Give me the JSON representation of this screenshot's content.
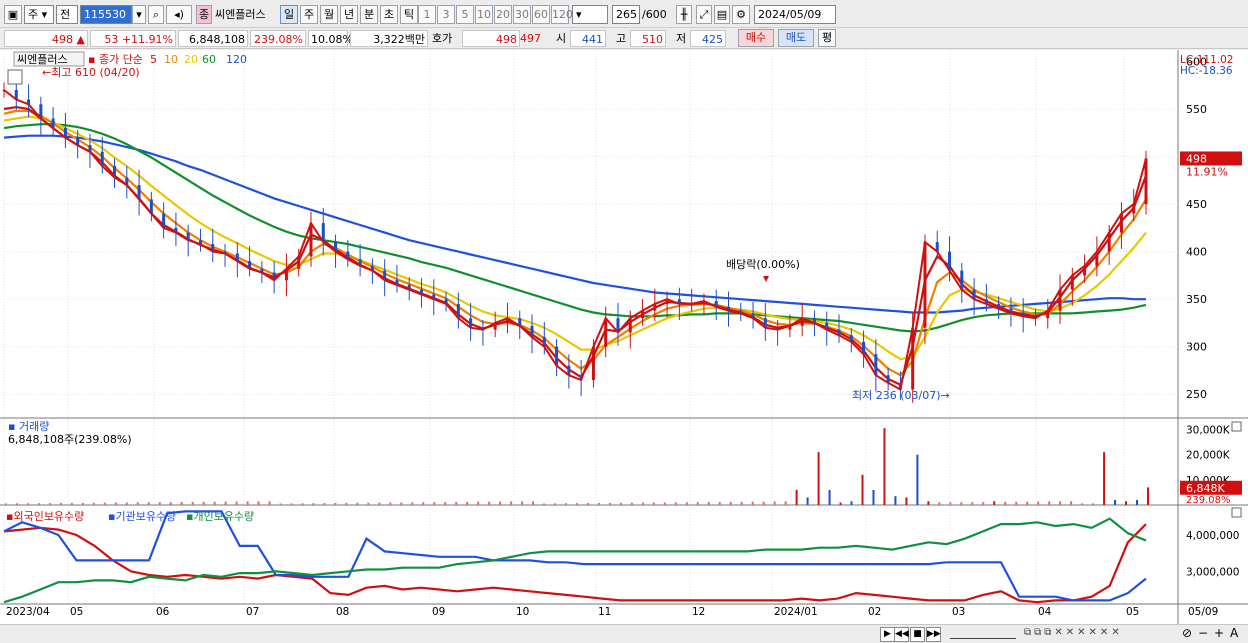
{
  "toolbar": {
    "market_label": "주",
    "prev_label": "전",
    "code": "115530",
    "type_label": "종",
    "stock_name": "씨엔플러스",
    "periods": [
      "일",
      "주",
      "월",
      "년",
      "분",
      "초",
      "틱"
    ],
    "intervals": [
      "1",
      "3",
      "5",
      "10",
      "20",
      "30",
      "60",
      "120"
    ],
    "count": "265",
    "max_count": "/600",
    "date": "2024/05/09"
  },
  "quote": {
    "price": "498",
    "change_arrow": "▲",
    "change": "53",
    "change_pct": "+11.91%",
    "volume": "6,848,108",
    "volume_pct": "239.08%",
    "turnover": "10.08%",
    "amount": "3,322백만",
    "bid_label": "호가",
    "ask": "498",
    "bid": "497",
    "open_label": "시",
    "open": "441",
    "high_label": "고",
    "high": "510",
    "low_label": "저",
    "low": "425",
    "buy_label": "매수",
    "sell_label": "매도",
    "eval_label": "평"
  },
  "legend": {
    "name": "씨엔플러스",
    "series_label": "종가 단순",
    "ma_periods": [
      "5",
      "10",
      "20",
      "60",
      "120"
    ],
    "ma_colors": [
      "#d01010",
      "#f08000",
      "#e8c800",
      "#10902a",
      "#2050e0"
    ]
  },
  "annotations": {
    "lc": "LC:111.02",
    "hc": "HC:-18.36",
    "high_mark": "최고 610 (04/20)",
    "low_mark": "최저 236 (03/07)",
    "dividend": "배당락(0.00%)",
    "price_tag": "498",
    "price_tag_pct": "11.91%"
  },
  "volume_panel": {
    "title": "거래량",
    "value": "6,848,108주(239.08%)",
    "tag": "6,848K",
    "tag_pct": "239.08%"
  },
  "holdings_panel": {
    "titles": [
      "외국인보유수량",
      "기관보유수량",
      "개인보유수량"
    ],
    "colors": [
      "#d01010",
      "#2050e0",
      "#109040"
    ]
  },
  "footer": {
    "buttons": [
      "▶",
      "◀◀",
      "■",
      "▶▶"
    ],
    "zoom": [
      "−",
      "+",
      "A"
    ]
  },
  "chart_data": {
    "type": "line",
    "x_labels": [
      "2023/04",
      "05",
      "06",
      "07",
      "08",
      "09",
      "10",
      "11",
      "12",
      "2024/01",
      "02",
      "03",
      "04",
      "05",
      "05/09"
    ],
    "price_axis": [
      250,
      300,
      350,
      400,
      450,
      500,
      550
    ],
    "price_axis_top": "600",
    "price_ylim": [
      225,
      610
    ],
    "volume_axis": [
      "10,000K",
      "20,000K",
      "30,000K"
    ],
    "volume_ylim": [
      0,
      31000
    ],
    "holdings_axis": [
      "3,000,000",
      "4,000,000"
    ],
    "holdings_ylim": [
      2100000,
      4800000
    ],
    "series": [
      {
        "name": "종가",
        "values": [
          570,
          560,
          555,
          540,
          530,
          520,
          512,
          505,
          490,
          478,
          470,
          455,
          440,
          425,
          420,
          412,
          408,
          400,
          398,
          390,
          382,
          378,
          370,
          382,
          395,
          430,
          410,
          400,
          392,
          385,
          380,
          370,
          365,
          360,
          355,
          350,
          345,
          330,
          320,
          318,
          325,
          330,
          322,
          310,
          300,
          280,
          270,
          265,
          300,
          330,
          315,
          330,
          338,
          345,
          350,
          345,
          345,
          348,
          342,
          338,
          335,
          330,
          320,
          318,
          322,
          330,
          325,
          318,
          312,
          305,
          292,
          270,
          262,
          255,
          320,
          410,
          400,
          380,
          360,
          350,
          345,
          340,
          335,
          332,
          330,
          338,
          360,
          375,
          385,
          400,
          420,
          440,
          450,
          498
        ]
      },
      {
        "name": "5",
        "values": [
          550,
          552,
          550,
          540,
          530,
          520,
          512,
          505,
          494,
          480,
          470,
          456,
          440,
          428,
          421,
          413,
          407,
          402,
          398,
          391,
          383,
          378,
          373,
          380,
          390,
          418,
          412,
          402,
          394,
          386,
          380,
          372,
          366,
          361,
          356,
          351,
          346,
          334,
          324,
          319,
          323,
          327,
          322,
          313,
          304,
          288,
          276,
          268,
          290,
          318,
          316,
          326,
          334,
          341,
          347,
          346,
          345,
          346,
          343,
          339,
          336,
          331,
          323,
          320,
          322,
          327,
          325,
          320,
          315,
          308,
          296,
          278,
          266,
          260,
          300,
          370,
          395,
          385,
          366,
          354,
          348,
          342,
          337,
          334,
          332,
          336,
          352,
          370,
          382,
          396,
          414,
          432,
          446,
          480
        ]
      },
      {
        "name": "10",
        "values": [
          545,
          548,
          548,
          543,
          535,
          526,
          518,
          510,
          500,
          488,
          477,
          465,
          452,
          440,
          430,
          420,
          412,
          405,
          400,
          394,
          388,
          382,
          376,
          378,
          384,
          400,
          408,
          404,
          397,
          390,
          384,
          377,
          371,
          366,
          361,
          356,
          351,
          342,
          333,
          326,
          324,
          325,
          323,
          317,
          309,
          297,
          286,
          277,
          286,
          302,
          310,
          319,
          327,
          334,
          340,
          343,
          344,
          345,
          344,
          341,
          338,
          334,
          328,
          324,
          323,
          325,
          324,
          321,
          317,
          311,
          301,
          289,
          277,
          270,
          285,
          330,
          368,
          378,
          370,
          360,
          353,
          347,
          341,
          337,
          334,
          334,
          345,
          358,
          370,
          384,
          400,
          418,
          434,
          455
        ]
      },
      {
        "name": "20",
        "values": [
          538,
          540,
          542,
          540,
          536,
          530,
          524,
          517,
          509,
          499,
          490,
          480,
          469,
          459,
          449,
          439,
          430,
          422,
          415,
          409,
          402,
          396,
          390,
          386,
          386,
          392,
          398,
          398,
          395,
          391,
          386,
          381,
          376,
          371,
          366,
          362,
          357,
          350,
          343,
          337,
          333,
          331,
          329,
          325,
          320,
          313,
          305,
          297,
          297,
          302,
          306,
          312,
          318,
          324,
          330,
          334,
          337,
          340,
          341,
          340,
          339,
          337,
          334,
          331,
          329,
          328,
          327,
          325,
          322,
          318,
          312,
          304,
          295,
          287,
          289,
          310,
          336,
          354,
          360,
          358,
          355,
          351,
          347,
          343,
          339,
          337,
          340,
          346,
          354,
          364,
          376,
          390,
          404,
          420
        ]
      },
      {
        "name": "60",
        "values": [
          530,
          532,
          533,
          534,
          534,
          533,
          531,
          528,
          524,
          519,
          513,
          506,
          499,
          491,
          483,
          475,
          467,
          459,
          452,
          445,
          438,
          432,
          426,
          421,
          417,
          414,
          412,
          410,
          408,
          405,
          402,
          399,
          396,
          393,
          389,
          386,
          383,
          379,
          375,
          371,
          367,
          363,
          359,
          355,
          351,
          347,
          343,
          339,
          336,
          334,
          333,
          332,
          332,
          332,
          333,
          333,
          334,
          334,
          335,
          335,
          335,
          334,
          333,
          332,
          331,
          330,
          329,
          328,
          327,
          325,
          323,
          321,
          319,
          317,
          316,
          317,
          320,
          324,
          328,
          331,
          333,
          334,
          335,
          335,
          335,
          335,
          335,
          335,
          336,
          337,
          338,
          339,
          341,
          344
        ]
      },
      {
        "name": "120",
        "values": [
          520,
          521,
          522,
          522,
          522,
          521,
          520,
          518,
          516,
          513,
          510,
          507,
          503,
          499,
          495,
          490,
          486,
          481,
          476,
          471,
          466,
          461,
          456,
          452,
          448,
          444,
          440,
          436,
          432,
          428,
          424,
          420,
          416,
          412,
          409,
          406,
          403,
          400,
          397,
          394,
          391,
          388,
          385,
          382,
          379,
          376,
          373,
          370,
          367,
          365,
          363,
          361,
          359,
          357,
          356,
          355,
          354,
          353,
          352,
          351,
          350,
          349,
          348,
          347,
          346,
          345,
          344,
          343,
          342,
          341,
          340,
          339,
          338,
          337,
          336,
          336,
          336,
          337,
          338,
          340,
          341,
          342,
          343,
          344,
          345,
          346,
          347,
          348,
          349,
          350,
          351,
          351,
          350,
          350
        ]
      },
      {
        "name": "외국인보유수량",
        "values": [
          4100000,
          4150000,
          4200000,
          4150000,
          4000000,
          3700000,
          3300000,
          3000000,
          2900000,
          2850000,
          2900000,
          2850000,
          2800000,
          2850000,
          2800000,
          2900000,
          2850000,
          2800000,
          2400000,
          2350000,
          2550000,
          2600000,
          2500000,
          2550000,
          2500000,
          2450000,
          2500000,
          2550000,
          2500000,
          2450000,
          2400000,
          2350000,
          2300000,
          2250000,
          2200000,
          2200000,
          2200000,
          2200000,
          2200000,
          2200000,
          2200000,
          2200000,
          2200000,
          2200000,
          2250000,
          2200000,
          2250000,
          2400000,
          2350000,
          2300000,
          2250000,
          2200000,
          2200000,
          2200000,
          2350000,
          2450000,
          2200000,
          2150000,
          2200000,
          2200000,
          2300000,
          2600000,
          3800000,
          4300000
        ]
      },
      {
        "name": "기관보유수량",
        "values": [
          4100000,
          4350000,
          4200000,
          4000000,
          3300000,
          3300000,
          3300000,
          3300000,
          3300000,
          4600000,
          4650000,
          4650000,
          4650000,
          3700000,
          3700000,
          2900000,
          2900000,
          2850000,
          2850000,
          2850000,
          3900000,
          3550000,
          3500000,
          3450000,
          3400000,
          3400000,
          3400000,
          3300000,
          3300000,
          3300000,
          3250000,
          3250000,
          3200000,
          3200000,
          3200000,
          3200000,
          3200000,
          3200000,
          3200000,
          3200000,
          3200000,
          3200000,
          3200000,
          3200000,
          3200000,
          3200000,
          3200000,
          3200000,
          3200000,
          3200000,
          3200000,
          3200000,
          3250000,
          3250000,
          3250000,
          3250000,
          2300000,
          2300000,
          2300000,
          2200000,
          2200000,
          2200000,
          2400000,
          2800000
        ]
      },
      {
        "name": "개인보유수량",
        "values": [
          2150000,
          2300000,
          2500000,
          2700000,
          2700000,
          2750000,
          2750000,
          2700000,
          2850000,
          2800000,
          2750000,
          2900000,
          2850000,
          2950000,
          2950000,
          3000000,
          2950000,
          2900000,
          2950000,
          3000000,
          3050000,
          3050000,
          3100000,
          3100000,
          3100000,
          3200000,
          3250000,
          3300000,
          3400000,
          3500000,
          3550000,
          3550000,
          3550000,
          3550000,
          3550000,
          3550000,
          3550000,
          3550000,
          3550000,
          3550000,
          3550000,
          3550000,
          3600000,
          3600000,
          3600000,
          3650000,
          3650000,
          3700000,
          3650000,
          3600000,
          3700000,
          3800000,
          3750000,
          3900000,
          4100000,
          4300000,
          4300000,
          4350000,
          4250000,
          4300000,
          4200000,
          4450000,
          4050000,
          3850000
        ]
      }
    ],
    "volume_spikes_K": [
      0,
      0,
      0,
      0,
      0,
      0,
      0,
      0,
      0,
      0,
      0,
      0,
      0,
      0,
      0,
      0,
      0,
      0,
      0,
      0,
      0,
      0,
      0,
      0,
      0,
      0,
      0,
      0,
      0,
      0,
      0,
      0,
      0,
      0,
      0,
      0,
      0,
      0,
      0,
      0,
      0,
      0,
      0,
      0,
      0,
      0,
      0,
      0,
      0,
      0,
      0,
      0,
      0,
      0,
      0,
      0,
      0,
      0,
      0,
      0,
      0,
      0,
      0,
      0,
      0,
      0,
      0,
      0,
      0,
      0,
      0,
      0,
      6000,
      3000,
      21000,
      6000,
      1000,
      1500,
      12000,
      6000,
      30500,
      3500,
      3000,
      20000,
      1500,
      0,
      0,
      0,
      0,
      0,
      1500,
      0,
      0,
      0,
      0,
      0,
      0,
      0,
      0,
      0,
      21000,
      2000,
      1500,
      2000,
      7000
    ]
  }
}
